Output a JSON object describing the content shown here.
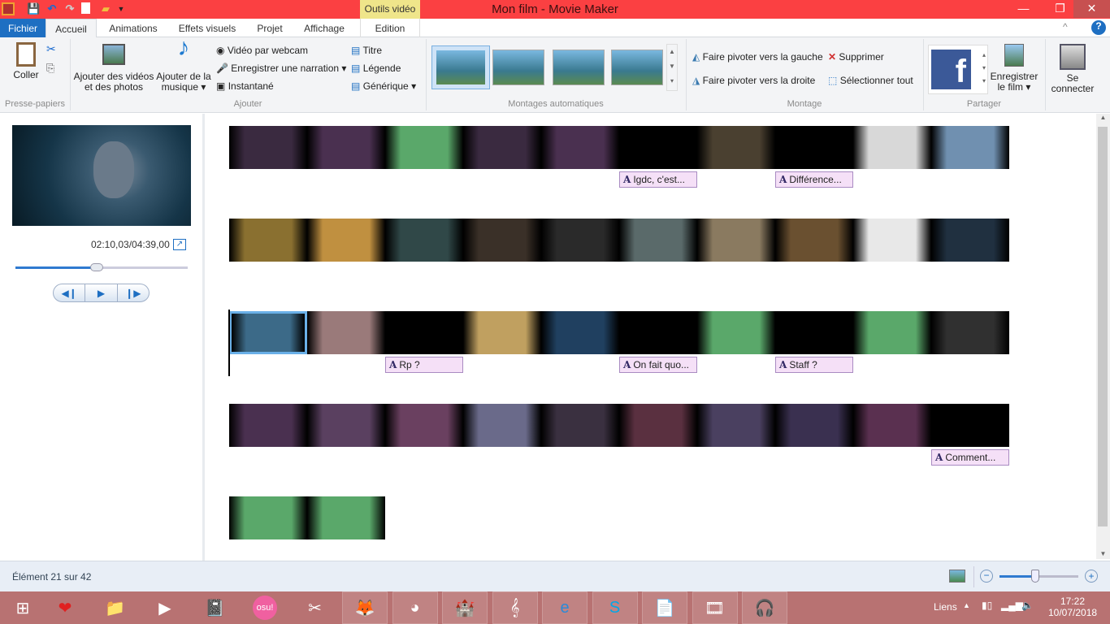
{
  "window": {
    "title": "Mon film - Movie Maker",
    "context_tab": "Outils vidéo"
  },
  "tabs": [
    "Fichier",
    "Accueil",
    "Animations",
    "Effets visuels",
    "Projet",
    "Affichage",
    "Edition"
  ],
  "ribbon": {
    "clipboard": {
      "paste": "Coller",
      "group": "Presse-papiers"
    },
    "add": {
      "add_videos": "Ajouter des vidéos et des photos",
      "add_music_1": "Ajouter de la",
      "add_music_2": "musique",
      "webcam": "Vidéo par webcam",
      "narration": "Enregistrer une narration",
      "snapshot": "Instantané",
      "title": "Titre",
      "caption": "Légende",
      "credits": "Générique",
      "group": "Ajouter"
    },
    "automovie": {
      "group": "Montages automatiques"
    },
    "editing": {
      "rotate_left": "Faire pivoter vers la gauche",
      "rotate_right": "Faire pivoter vers la droite",
      "delete": "Supprimer",
      "select_all": "Sélectionner tout",
      "group": "Montage"
    },
    "share": {
      "save_1": "Enregistrer",
      "save_2": "le film",
      "group": "Partager"
    },
    "signin": {
      "l1": "Se",
      "l2": "connecter"
    }
  },
  "preview": {
    "time": "02:10,03/04:39,00",
    "progress": 0.47
  },
  "timeline": {
    "rows": [
      [
        "#3a2a40",
        "#4a3050",
        "#5aa86a",
        "#3a2a40",
        "#4a3050",
        "#000000",
        "#4a4030",
        "#000000",
        "#d8d8d8",
        "#7090b0"
      ],
      [
        "#8a7030",
        "#c09040",
        "#304848",
        "#3a3028",
        "#2a2a2a",
        "#5a6a6a",
        "#8a7a60",
        "#6a5030",
        "#e8e8e8",
        "#203040"
      ],
      [
        "#3c6a88",
        "#9a7a7a",
        "#000000",
        "#c0a060",
        "#204060",
        "#000000",
        "#5aa86a",
        "#000000",
        "#5aa86a",
        "#303030"
      ],
      [
        "#4a3050",
        "#5a4060",
        "#6a4060",
        "#6a6a8a",
        "#3a3040",
        "#5a3040",
        "#4a4060",
        "#3a3050",
        "#5a3050",
        "#000000"
      ],
      [
        "#5aa86a",
        "#5aa86a"
      ]
    ],
    "captions": [
      {
        "row": 0,
        "clip": 5,
        "text": "Igdc, c'est..."
      },
      {
        "row": 0,
        "clip": 7,
        "text": "Différence..."
      },
      {
        "row": 2,
        "clip": 2,
        "text": "Rp ?"
      },
      {
        "row": 2,
        "clip": 5,
        "text": "On fait quo..."
      },
      {
        "row": 2,
        "clip": 7,
        "text": "Staff ?"
      },
      {
        "row": 3,
        "clip": 9,
        "text": "Comment..."
      }
    ]
  },
  "status": {
    "text": "Élément 21 sur 42",
    "zoom_level": 0.45
  },
  "taskbar": {
    "items": [
      "windows-start",
      "heart-app",
      "file-explorer",
      "media-player",
      "notepad",
      "osu",
      "scissors-app",
      "gimp",
      "green-app",
      "castle-game",
      "musescore",
      "internet-explorer",
      "skype",
      "word-document",
      "movie-maker",
      "audacity"
    ],
    "osu_label": "osu!",
    "links": "Liens",
    "time": "17:22",
    "date": "10/07/2018"
  }
}
